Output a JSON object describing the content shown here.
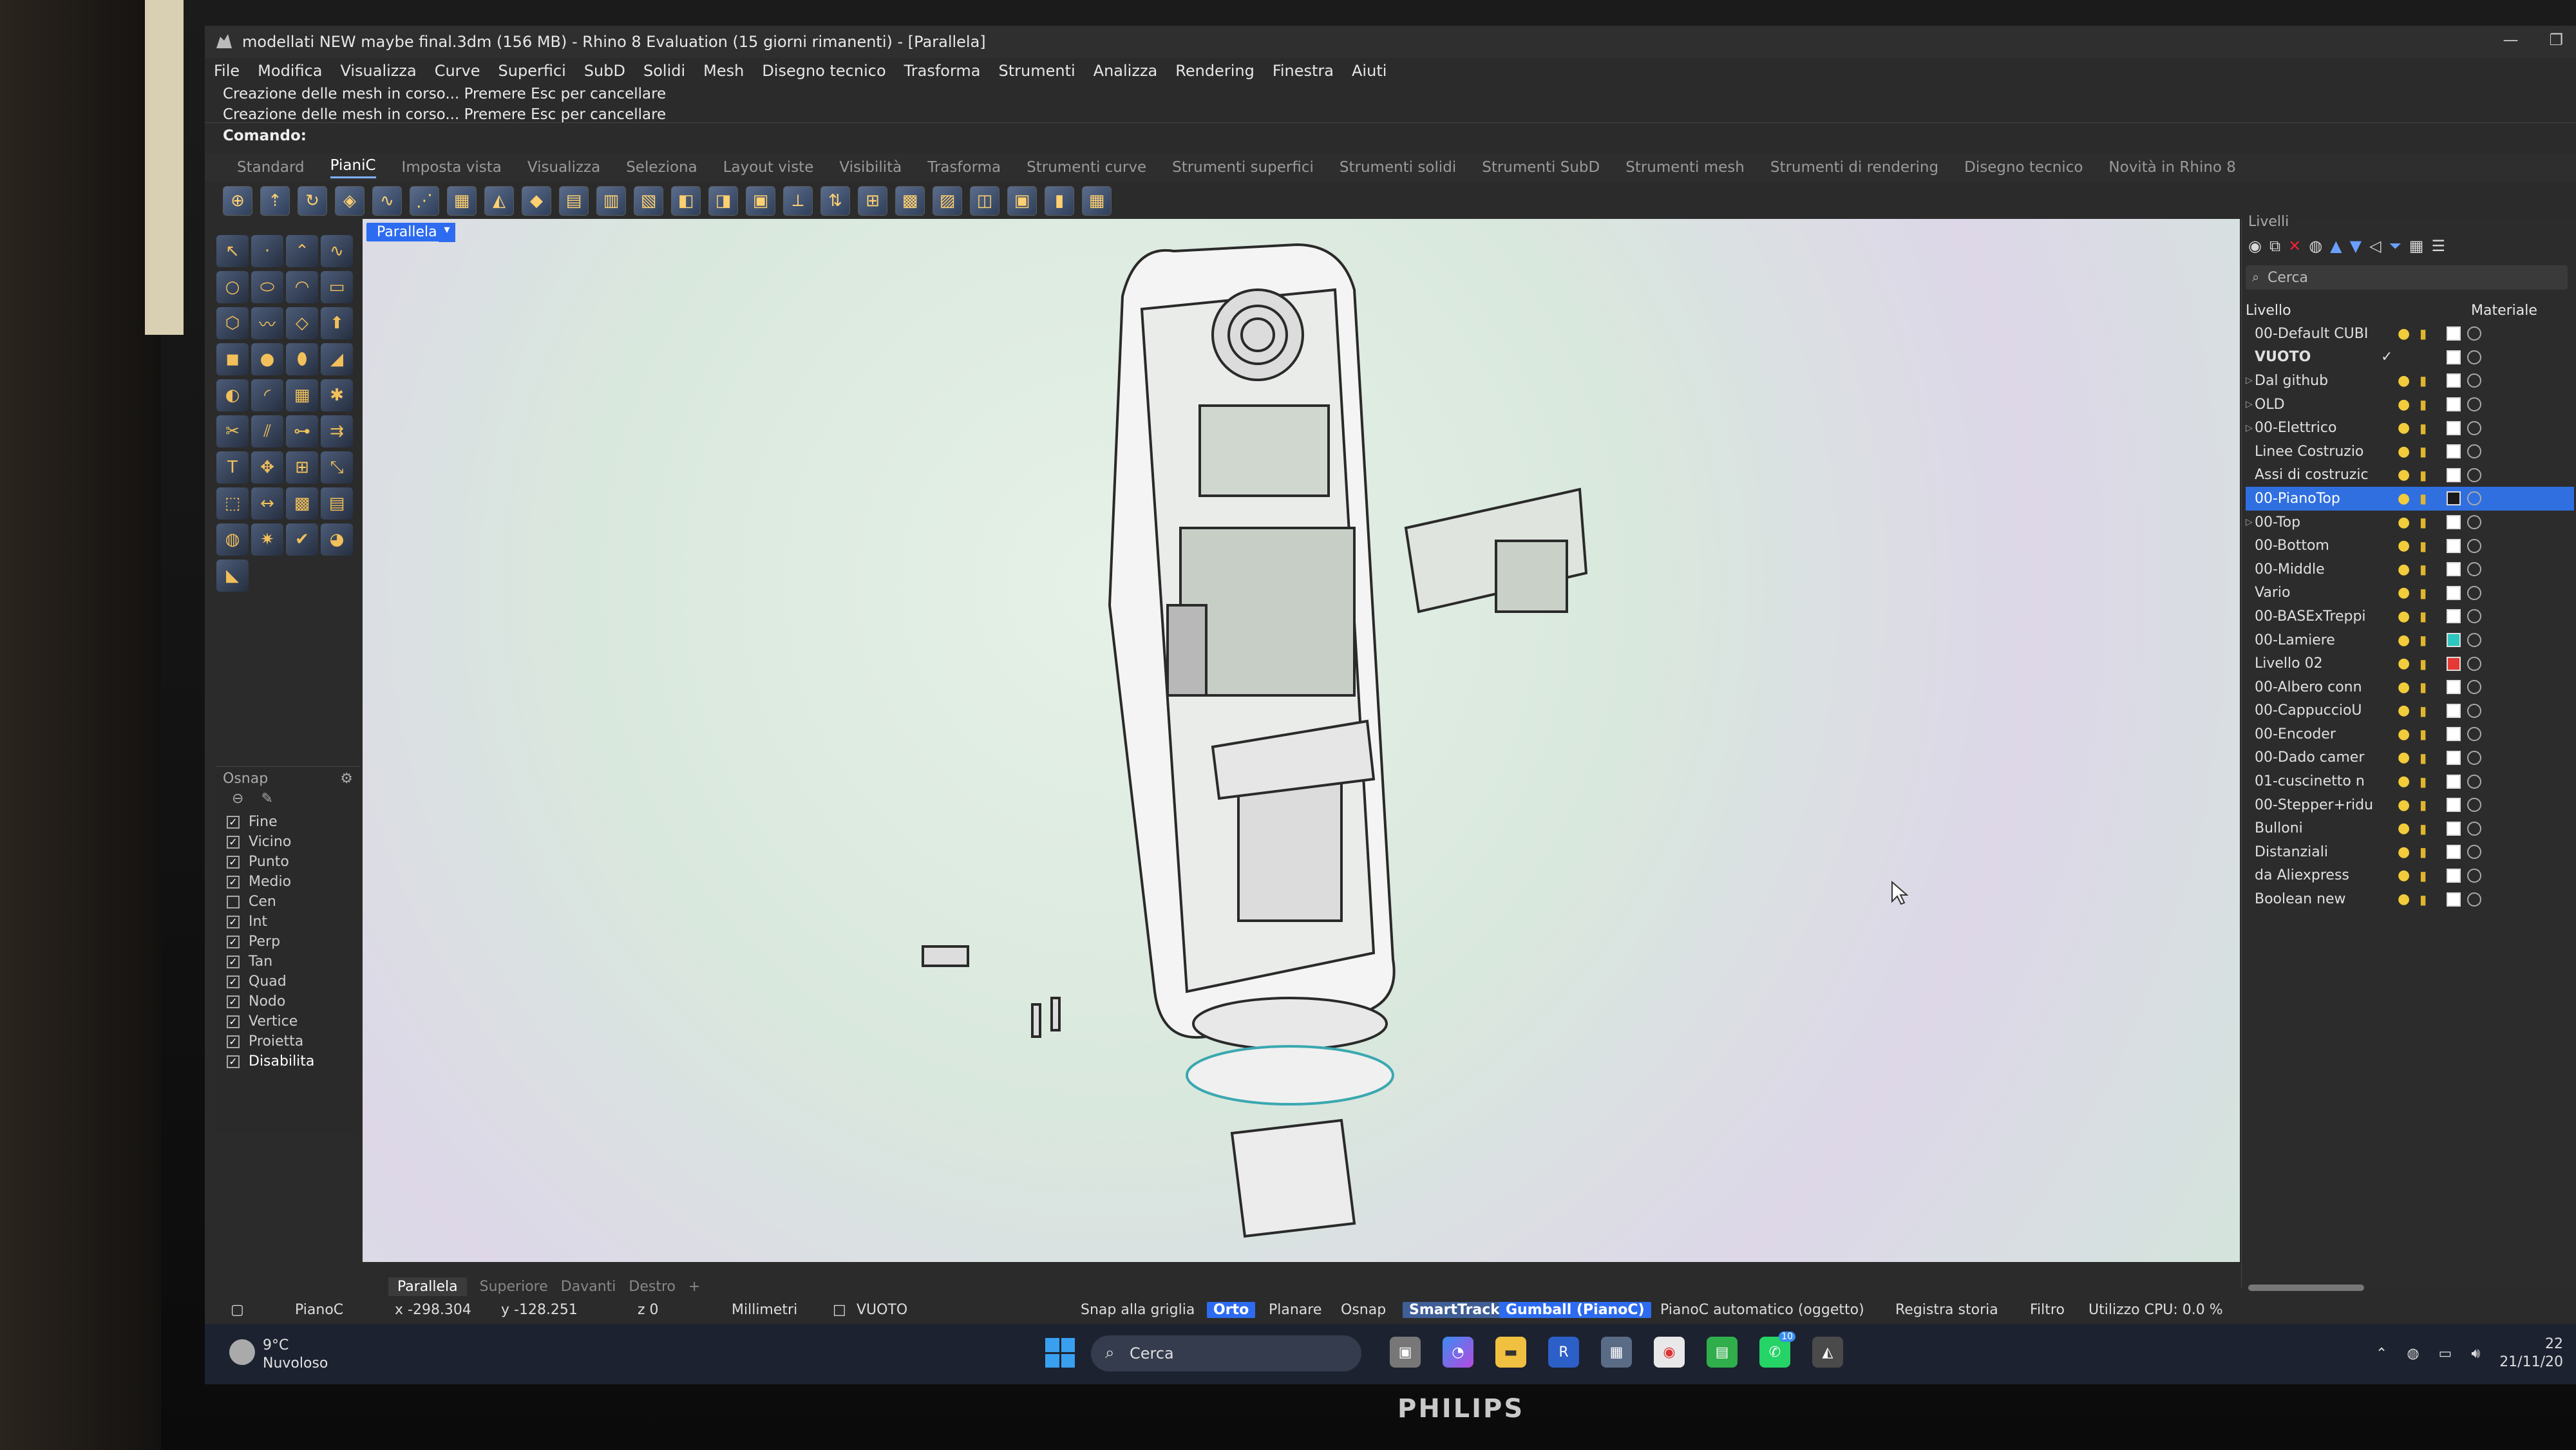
{
  "brand": "PHILIPS",
  "window": {
    "title": "modellati NEW maybe final.3dm (156 MB) - Rhino 8 Evaluation (15 giorni rimanenti) - [Parallela]",
    "controls": [
      "—",
      "❐"
    ]
  },
  "menu": [
    "File",
    "Modifica",
    "Visualizza",
    "Curve",
    "Superfici",
    "SubD",
    "Solidi",
    "Mesh",
    "Disegno tecnico",
    "Trasforma",
    "Strumenti",
    "Analizza",
    "Rendering",
    "Finestra",
    "Aiuti"
  ],
  "history": [
    "Creazione delle mesh in corso... Premere Esc per cancellare",
    "Creazione delle mesh in corso... Premere Esc per cancellare"
  ],
  "command_label": "Comando:",
  "tabs": [
    "Standard",
    "PianiC",
    "Imposta vista",
    "Visualizza",
    "Seleziona",
    "Layout viste",
    "Visibilità",
    "Trasforma",
    "Strumenti curve",
    "Strumenti superfici",
    "Strumenti solidi",
    "Strumenti SubD",
    "Strumenti mesh",
    "Strumenti di rendering",
    "Disegno tecnico",
    "Novità in Rhino 8"
  ],
  "active_tab": "PianiC",
  "viewport": {
    "label": "Parallela",
    "caret": "▾"
  },
  "osnap": {
    "title": "Osnap",
    "items": [
      {
        "label": "Fine",
        "checked": true
      },
      {
        "label": "Vicino",
        "checked": true
      },
      {
        "label": "Punto",
        "checked": true
      },
      {
        "label": "Medio",
        "checked": true
      },
      {
        "label": "Cen",
        "checked": false
      },
      {
        "label": "Int",
        "checked": true
      },
      {
        "label": "Perp",
        "checked": true
      },
      {
        "label": "Tan",
        "checked": true
      },
      {
        "label": "Quad",
        "checked": true
      },
      {
        "label": "Nodo",
        "checked": true
      },
      {
        "label": "Vertice",
        "checked": true
      },
      {
        "label": "Proietta",
        "checked": true
      },
      {
        "label": "Disabilita",
        "checked": true
      }
    ]
  },
  "layers": {
    "title": "Livelli",
    "search_placeholder": "Cerca",
    "col_layer": "Livello",
    "col_material": "Materiale",
    "rows": [
      {
        "name": "00-Default CUBI",
        "arrow": "",
        "color": "#ffffff",
        "selected": false,
        "bold": false
      },
      {
        "name": "VUOTO",
        "arrow": "",
        "color": "#ffffff",
        "selected": false,
        "bold": true,
        "current": true
      },
      {
        "name": "Dal github",
        "arrow": "▷",
        "color": "#ffffff",
        "selected": false,
        "bold": false
      },
      {
        "name": "OLD",
        "arrow": "▷",
        "color": "#ffffff",
        "selected": false,
        "bold": false
      },
      {
        "name": "00-Elettrico",
        "arrow": "▷",
        "color": "#ffffff",
        "selected": false,
        "bold": false
      },
      {
        "name": "Linee Costruzio",
        "arrow": "",
        "color": "#ffffff",
        "selected": false,
        "bold": false
      },
      {
        "name": "Assi di costruzic",
        "arrow": "",
        "color": "#ffffff",
        "selected": false,
        "bold": false
      },
      {
        "name": "00-PianoTop",
        "arrow": "",
        "color": "#1a1a1a",
        "selected": true,
        "bold": false
      },
      {
        "name": "00-Top",
        "arrow": "▷",
        "color": "#ffffff",
        "selected": false,
        "bold": false
      },
      {
        "name": "00-Bottom",
        "arrow": "",
        "color": "#ffffff",
        "selected": false,
        "bold": false
      },
      {
        "name": "00-Middle",
        "arrow": "",
        "color": "#ffffff",
        "selected": false,
        "bold": false
      },
      {
        "name": "Vario",
        "arrow": "",
        "color": "#ffffff",
        "selected": false,
        "bold": false
      },
      {
        "name": "00-BASExTreppi",
        "arrow": "",
        "color": "#ffffff",
        "selected": false,
        "bold": false
      },
      {
        "name": "00-Lamiere",
        "arrow": "",
        "color": "#2bc7c0",
        "selected": false,
        "bold": false
      },
      {
        "name": "Livello 02",
        "arrow": "",
        "color": "#e53935",
        "selected": false,
        "bold": false
      },
      {
        "name": "00-Albero conn",
        "arrow": "",
        "color": "#ffffff",
        "selected": false,
        "bold": false
      },
      {
        "name": "00-CappuccioU",
        "arrow": "",
        "color": "#ffffff",
        "selected": false,
        "bold": false
      },
      {
        "name": "00-Encoder",
        "arrow": "",
        "color": "#ffffff",
        "selected": false,
        "bold": false
      },
      {
        "name": "00-Dado camer",
        "arrow": "",
        "color": "#ffffff",
        "selected": false,
        "bold": false
      },
      {
        "name": "01-cuscinetto n",
        "arrow": "",
        "color": "#ffffff",
        "selected": false,
        "bold": false
      },
      {
        "name": "00-Stepper+ridu",
        "arrow": "",
        "color": "#ffffff",
        "selected": false,
        "bold": false
      },
      {
        "name": "Bulloni",
        "arrow": "",
        "color": "#ffffff",
        "selected": false,
        "bold": false
      },
      {
        "name": "Distanziali",
        "arrow": "",
        "color": "#ffffff",
        "selected": false,
        "bold": false
      },
      {
        "name": "da Aliexpress",
        "arrow": "",
        "color": "#ffffff",
        "selected": false,
        "bold": false
      },
      {
        "name": "Boolean new",
        "arrow": "",
        "color": "#ffffff",
        "selected": false,
        "bold": false
      }
    ]
  },
  "viewport_tabs": [
    "Parallela",
    "Superiore",
    "Davanti",
    "Destro",
    "+"
  ],
  "status": {
    "cplane": "PianoC",
    "x": "x -298.304",
    "y": "y -128.251",
    "z": "z 0",
    "units": "Millimetri",
    "layer": "VUOTO",
    "grid_snap": "Snap alla griglia",
    "ortho": "Orto",
    "planar": "Planare",
    "osnap": "Osnap",
    "smarttrack": "SmartTrack",
    "gumball": "Gumball (PianoC)",
    "auto_cplane": "PianoC automatico (oggetto)",
    "history": "Registra storia",
    "filter": "Filtro",
    "cpu": "Utilizzo CPU: 0.0 %"
  },
  "taskbar": {
    "temperature": "9°C",
    "weather": "Nuvoloso",
    "search": "Cerca",
    "time": "22",
    "date": "21/11/20",
    "badge": "10"
  }
}
